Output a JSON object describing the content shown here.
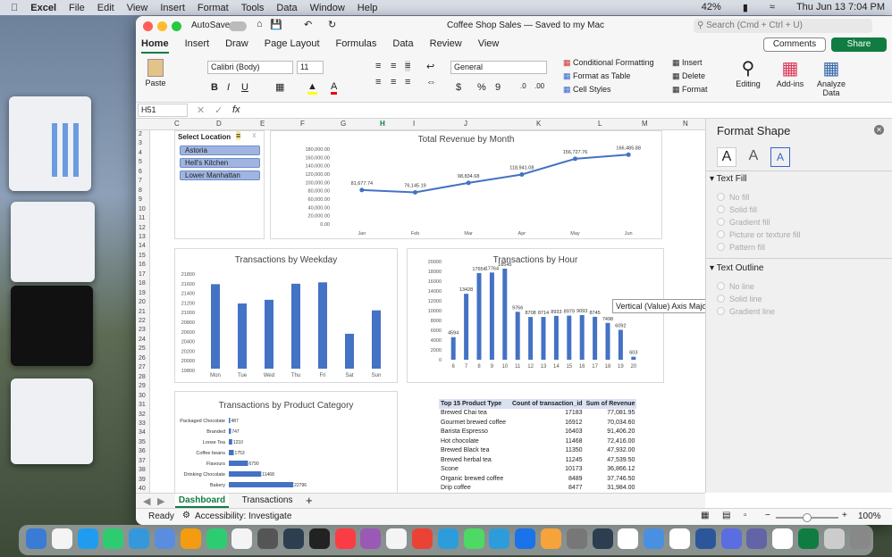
{
  "menubar": {
    "app": "Excel",
    "items": [
      "File",
      "Edit",
      "View",
      "Insert",
      "Format",
      "Tools",
      "Data",
      "Window",
      "Help"
    ],
    "battery": "42%",
    "datetime": "Thu Jun 13  7:04 PM"
  },
  "window": {
    "autosave": "AutoSave",
    "title": "Coffee Shop Sales — Saved to my Mac",
    "search_placeholder": "Search (Cmd + Ctrl + U)"
  },
  "ribbon_tabs": [
    "Home",
    "Insert",
    "Draw",
    "Page Layout",
    "Formulas",
    "Data",
    "Review",
    "View"
  ],
  "ribbon": {
    "comments": "Comments",
    "share": "Share",
    "paste": "Paste",
    "font": "Calibri (Body)",
    "size": "11",
    "number_format": "General",
    "cond_format": "Conditional Formatting",
    "format_table": "Format as Table",
    "cell_styles": "Cell Styles",
    "insert": "Insert",
    "delete": "Delete",
    "format": "Format",
    "editing": "Editing",
    "addins": "Add-ins",
    "analyze": "Analyze Data"
  },
  "formula_bar": {
    "cell_ref": "H51",
    "fx": "fx"
  },
  "columns": [
    "C",
    "D",
    "E",
    "F",
    "G",
    "H",
    "I",
    "J",
    "K",
    "L",
    "M",
    "N"
  ],
  "rows": [
    "2",
    "3",
    "4",
    "5",
    "6",
    "7",
    "8",
    "9",
    "10",
    "11",
    "12",
    "13",
    "14",
    "15",
    "16",
    "17",
    "18",
    "19",
    "20",
    "21",
    "22",
    "23",
    "24",
    "25",
    "26",
    "27",
    "28",
    "29",
    "30",
    "31",
    "32",
    "33",
    "34",
    "35",
    "36",
    "37",
    "38",
    "39",
    "40"
  ],
  "slicer": {
    "title": "Select Location",
    "items": [
      "Astoria",
      "Hell's Kitchen",
      "Lower Manhattan"
    ]
  },
  "chart_data": [
    {
      "type": "line",
      "title": "Total Revenue by Month",
      "categories": [
        "Jan",
        "Feb",
        "Mar",
        "Apr",
        "May",
        "Jun"
      ],
      "values": [
        81677.74,
        76145.19,
        98834.68,
        118941.08,
        156727.76,
        166485.88
      ],
      "labels": [
        "81,677.74",
        "76,145.19",
        "98,834.68",
        "118,941.08",
        "156,727.76",
        "166,485.88"
      ],
      "yticks": [
        "180,000.00",
        "160,000.00",
        "140,000.00",
        "120,000.00",
        "100,000.00",
        "80,000.00",
        "60,000.00",
        "40,000.00",
        "20,000.00",
        "0.00"
      ],
      "ylim": [
        0,
        180000
      ],
      "color": "#4472c4"
    },
    {
      "type": "bar",
      "title": "Transactions by Weekday",
      "categories": [
        "Mon",
        "Tue",
        "Wed",
        "Thu",
        "Fri",
        "Sat",
        "Sun"
      ],
      "values": [
        21640,
        21220,
        21300,
        21650,
        21680,
        20560,
        21070
      ],
      "yticks": [
        "21800",
        "21600",
        "21400",
        "21200",
        "21000",
        "20800",
        "20600",
        "20400",
        "20200",
        "20000",
        "19800"
      ],
      "ylim": [
        19800,
        21900
      ],
      "color": "#4472c4"
    },
    {
      "type": "bar",
      "title": "Transactions by Hour",
      "categories": [
        "6",
        "7",
        "8",
        "9",
        "10",
        "11",
        "12",
        "13",
        "14",
        "15",
        "16",
        "17",
        "18",
        "19",
        "20"
      ],
      "values": [
        4594,
        13428,
        17654,
        17764,
        18545,
        9766,
        8708,
        8714,
        8933,
        8979,
        9093,
        8745,
        7498,
        6092,
        603
      ],
      "yticks": [
        "20000",
        "18000",
        "16000",
        "14000",
        "12000",
        "10000",
        "8000",
        "6000",
        "4000",
        "2000",
        "0"
      ],
      "ylim": [
        0,
        20000
      ],
      "color": "#4472c4"
    },
    {
      "type": "bar",
      "orientation": "horizontal",
      "title": "Transactions by Product Category",
      "categories": [
        "Packaged Chocolate",
        "Branded",
        "Loose Tea",
        "Coffee beans",
        "Flavours",
        "Drinking Chocolate",
        "Bakery"
      ],
      "values": [
        487,
        747,
        1210,
        1753,
        6790,
        11468,
        22796
      ],
      "xmax": 60000,
      "color": "#4472c4"
    }
  ],
  "tooltip": "Vertical (Value) Axis Major Gridlines",
  "pivot": {
    "headers": [
      "Top 15 Product Type",
      "Count of transaction_id",
      "Sum of Revenue"
    ],
    "rows": [
      [
        "Brewed Chai tea",
        "17183",
        "77,081.95"
      ],
      [
        "Gourmet brewed coffee",
        "16912",
        "70,034.60"
      ],
      [
        "Barista Espresso",
        "16403",
        "91,406.20"
      ],
      [
        "Hot chocolate",
        "11468",
        "72,416.00"
      ],
      [
        "Brewed Black tea",
        "11350",
        "47,932.00"
      ],
      [
        "Brewed herbal tea",
        "11245",
        "47,539.50"
      ],
      [
        "Scone",
        "10173",
        "36,866.12"
      ],
      [
        "Organic brewed coffee",
        "8489",
        "37,746.50"
      ],
      [
        "Drip coffee",
        "8477",
        "31,984.00"
      ]
    ]
  },
  "format_panel": {
    "title": "Format Shape",
    "fill_section": "Text Fill",
    "fill_options": [
      "No fill",
      "Solid fill",
      "Gradient fill",
      "Picture or texture fill",
      "Pattern fill"
    ],
    "outline_section": "Text Outline",
    "outline_options": [
      "No line",
      "Solid line",
      "Gradient line"
    ]
  },
  "sheet_tabs": {
    "tabs": [
      "Dashboard",
      "Transactions"
    ],
    "add": "+"
  },
  "status": {
    "ready": "Ready",
    "accessibility": "Accessibility: Investigate",
    "zoom": "100%"
  }
}
